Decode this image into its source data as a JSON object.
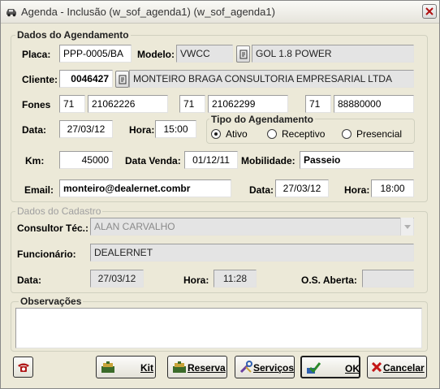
{
  "window": {
    "title": "Agenda - Inclusão (w_sof_agenda1) (w_sof_agenda1)",
    "icon": "car-icon"
  },
  "agendamento": {
    "group_title": "Dados do Agendamento",
    "placa_label": "Placa:",
    "placa_value": "PPP-0005/BA",
    "modelo_label": "Modelo:",
    "modelo_code": "VWCC",
    "modelo_desc": "GOL 1.8 POWER",
    "cliente_label": "Cliente:",
    "cliente_code": "0046427",
    "cliente_name": "MONTEIRO BRAGA CONSULTORIA EMPRESARIAL LTDA",
    "fones_label": "Fones",
    "fones": [
      {
        "ddd": "71",
        "numero": "21062226"
      },
      {
        "ddd": "71",
        "numero": "21062299"
      },
      {
        "ddd": "71",
        "numero": "88880000"
      }
    ],
    "data_label": "Data:",
    "data_value": "27/03/12",
    "hora_label": "Hora:",
    "hora_value": "15:00",
    "tipo_label": "Tipo do Agendamento",
    "tipo_options": [
      "Ativo",
      "Receptivo",
      "Presencial"
    ],
    "tipo_selected": "Ativo",
    "km_label": "Km:",
    "km_value": "45000",
    "data_venda_label": "Data Venda:",
    "data_venda_value": "01/12/11",
    "mobilidade_label": "Mobilidade:",
    "mobilidade_value": "Passeio",
    "email_label": "Email:",
    "email_value": "monteiro@dealernet.combr",
    "email_data_label": "Data:",
    "email_data_value": "27/03/12",
    "email_hora_label": "Hora:",
    "email_hora_value": "18:00"
  },
  "cadastro": {
    "group_title": "Dados do Cadastro",
    "consultor_label": "Consultor Téc.:",
    "consultor_value": "ALAN CARVALHO",
    "funcionario_label": "Funcionário:",
    "funcionario_value": "DEALERNET",
    "data_label": "Data:",
    "data_value": "27/03/12",
    "hora_label": "Hora:",
    "hora_value": "11:28",
    "os_label": "O.S. Aberta:",
    "os_value": ""
  },
  "observacoes": {
    "group_title": "Observações",
    "value": ""
  },
  "buttons": {
    "phone_icon": "telephone-icon",
    "kit": "Kit",
    "reserva": "Reserva",
    "servicos": "Serviços",
    "ok": "OK",
    "cancelar": "Cancelar"
  }
}
